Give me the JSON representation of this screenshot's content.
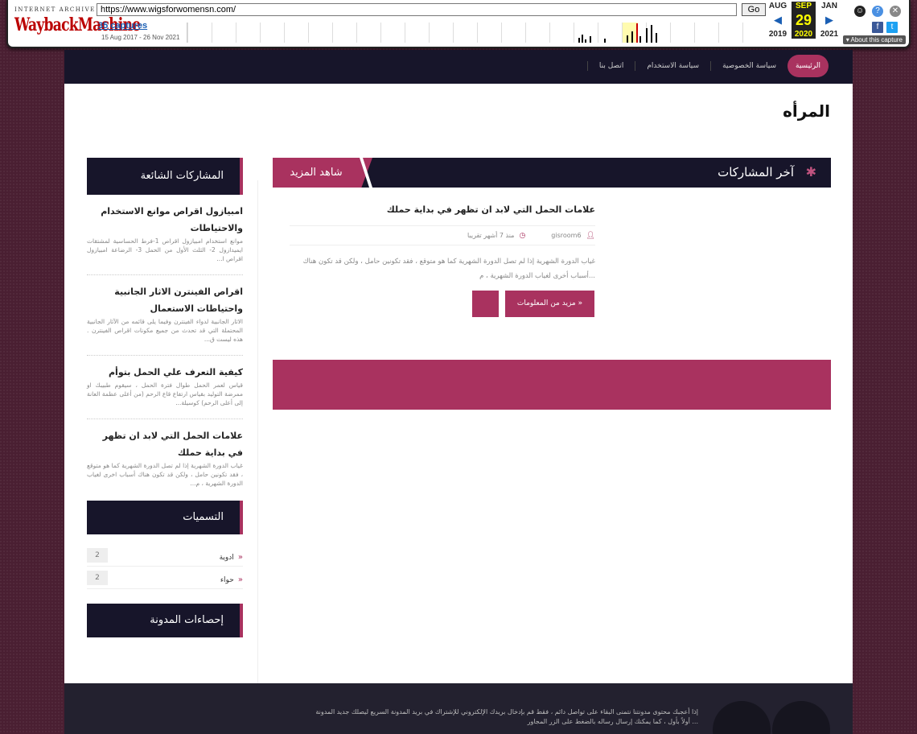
{
  "wayback": {
    "logo_top": "INTERNET ARCHIVE",
    "logo": "WaybackMachine",
    "url": "https://www.wigsforwomensn.com/",
    "go_label": "Go",
    "captures": "35 captures",
    "range": "15 Aug 2017 - 26 Nov 2021",
    "prev_month": "AUG",
    "cur_month": "SEP",
    "next_month": "JAN",
    "day": "29",
    "prev_year": "2019",
    "cur_year": "2020",
    "next_year": "2021",
    "about": "About this capture"
  },
  "nav": {
    "items": [
      {
        "label": "الرئيسية",
        "active": true
      },
      {
        "label": "سياسة الخصوصية"
      },
      {
        "label": "سياسة الاستخدام"
      },
      {
        "label": "اتصل بنا"
      }
    ]
  },
  "site": {
    "title": "المرأه"
  },
  "main": {
    "section_title": "آخر المشاركات",
    "see_more": "شاهد المزيد",
    "post": {
      "title": "علامات الحمل التي لابد ان تظهر في بداية حملك",
      "author": "gisroom6",
      "time": "منذ 7 أشهر تقريبا",
      "excerpt": "غياب الدورة الشهرية إذا لم تصل الدورة الشهرية كما هو متوقع ، فقد تكونين حامل ، ولكن قد تكون هناك أسباب أخرى لغياب الدورة الشهرية ، م...",
      "more_label": "مزيد من المعلومات »"
    }
  },
  "sidebar": {
    "popular_title": "المشاركات الشائعة",
    "popular": [
      {
        "title": "امبيازول اقراص موانع الاستخدام والاحتياطات",
        "excerpt": "موانع استخدام امبيازول اقراص 1-فرط الحساسية لمشتقات ايميدازول 2- الثلث الأول من الحمل 3- الرضاعة امبيازول اقراص ا..."
      },
      {
        "title": "اقراص الفينترن الاثار الجانبية واحتياطات الاستعمال",
        "excerpt": "الاثار الجانبية لدواء الفينترن وفيما يلى قائمه من الآثار الجانبية المحتملة التي قد تحدث من جميع مكونات اقراص الفينترن . هذه ليست ق..."
      },
      {
        "title": "كيفية التعرف علي الحمل بتوأم",
        "excerpt": "قياس لعمر الحمل طوال فترة الحمل ، سيقوم طبيبك او ممرضة التوليد بقياس ارتفاع قاع الرحم (من أعلى عظمة العانة إلى أعلى الرحم) كوسيلة..."
      },
      {
        "title": "علامات الحمل التي لابد ان تظهر في بداية حملك",
        "excerpt": "غياب الدورة الشهرية إذا لم تصل الدورة الشهرية كما هو متوقع ، فقد تكونين حامل ، ولكن قد تكون هناك أسباب اخرى لغياب الدورة الشهرية ، م..."
      }
    ],
    "labels_title": "التسميات",
    "labels": [
      {
        "name": "ادوية",
        "count": "2"
      },
      {
        "name": "حواء",
        "count": "2"
      }
    ],
    "stats_title": "إحصاءات المدونة"
  },
  "footer": {
    "text": "إذا أعجبك محتوى مدونتنا نتمنى البقاء على تواصل دائم ، فقط قم بإدخال بريدك الإلكتروني للإشتراك في بريد المدونة السريع ليصلك جديد المدونة أولاً بأول ، كما يمكنك إرسال رساله بالضغط على الزر المجاور ..."
  },
  "colors": {
    "accent": "#a9325f",
    "dark": "#17152a"
  }
}
